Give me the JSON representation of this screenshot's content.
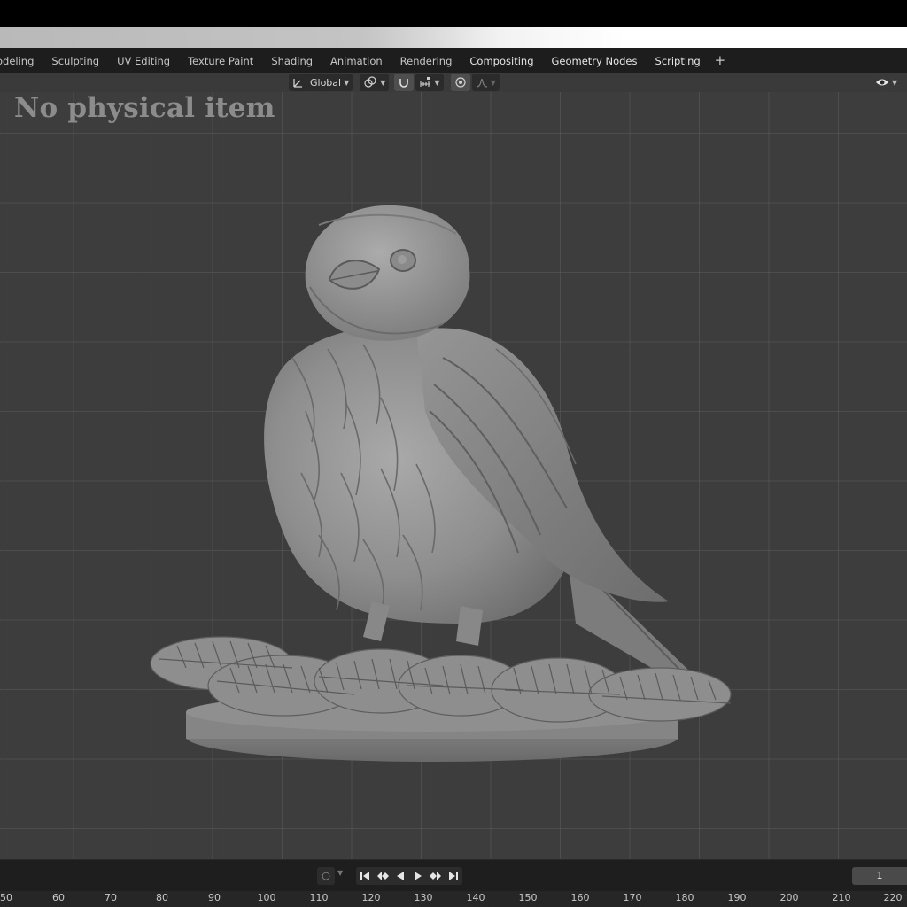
{
  "workspace_tabs": [
    "odeling",
    "Sculpting",
    "UV Editing",
    "Texture Paint",
    "Shading",
    "Animation",
    "Rendering",
    "Compositing",
    "Geometry Nodes",
    "Scripting"
  ],
  "add_workspace": "+",
  "header": {
    "transform_orientation": "Global",
    "icons": [
      "orientation-icon",
      "pivot-icon",
      "snap-icon",
      "snap-increment-icon",
      "proportional-edit-icon",
      "falloff-icon",
      "visibility-icon"
    ]
  },
  "viewport": {
    "watermark": "No physical item",
    "model": "bird-on-pine-branch-sculpt"
  },
  "timeline": {
    "current_frame": "1",
    "ruler": [
      "50",
      "60",
      "70",
      "80",
      "90",
      "100",
      "110",
      "120",
      "130",
      "140",
      "150",
      "160",
      "170",
      "180",
      "190",
      "200",
      "210",
      "220"
    ]
  },
  "colors": {
    "viewport_bg": "#3d3d3d",
    "grid": "#5a5a5a",
    "header_bg": "#3a3a3a",
    "tabs_bg": "#1d1d1d",
    "model_base": "#8c8c8c"
  }
}
